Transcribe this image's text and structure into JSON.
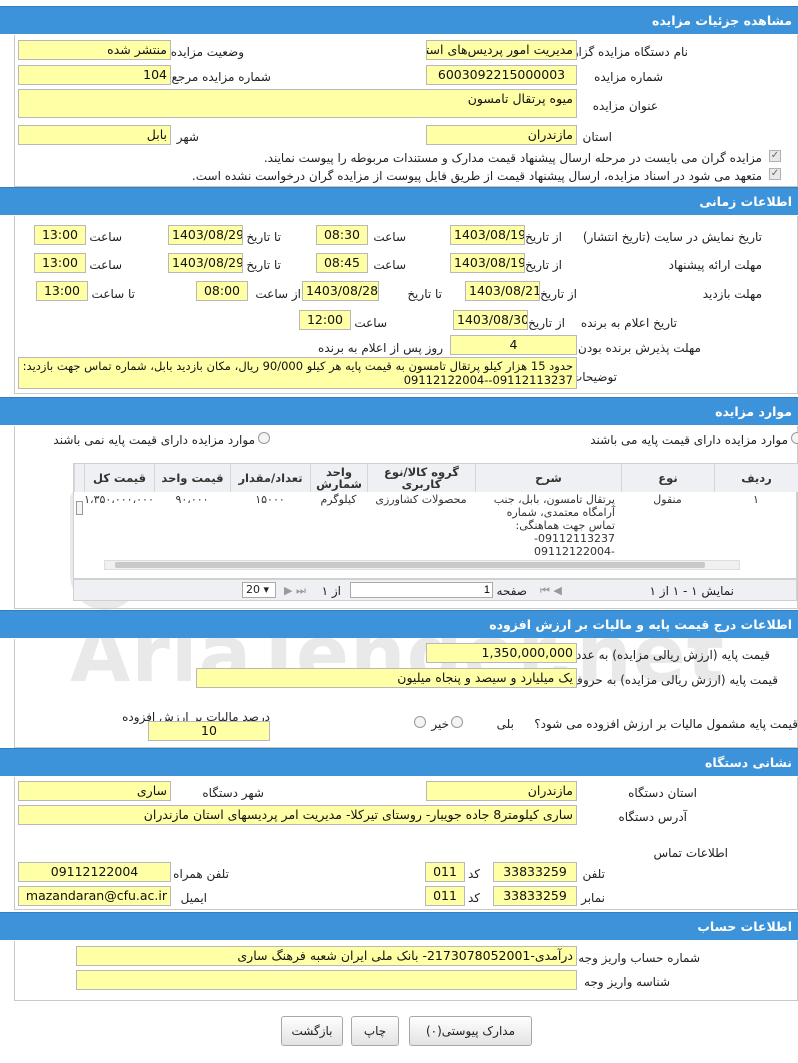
{
  "sections": {
    "details": "مشاهده جزئیات مزایده",
    "time": "اطلاعات زمانی",
    "items": "موارد مزایده",
    "price": "اطلاعات درج قیمت پایه و مالیات بر ارزش افزوده",
    "org": "نشانی دستگاه",
    "account": "اطلاعات حساب"
  },
  "details": {
    "org_label": "نام دستگاه مزایده گزار",
    "org_value": "مدیریت امور پردیس‌های استان مازندران",
    "status_label": "وضعیت مزایده",
    "status_value": "منتشر شده",
    "number_label": "شماره مزایده",
    "number_value": "6003092215000003",
    "ref_label": "شماره مزایده مرجع",
    "ref_value": "104",
    "title_label": "عنوان مزایده",
    "title_value": "میوه پرتقال تامسون",
    "province_label": "استان",
    "province_value": "مازندران",
    "city_label": "شهر",
    "city_value": "بابل",
    "check1": "مزایده گران می بایست در مرحله ارسال پیشنهاد قیمت مدارک و مستندات مربوطه را پیوست نمایند.",
    "check2": "متعهد می شود در اسناد مزایده، ارسال پیشنهاد قیمت از طریق فایل پیوست از مزایده گران درخواست نشده است."
  },
  "time": {
    "from": "از تاریخ",
    "to": "تا تاریخ",
    "hour": "ساعت",
    "from_hour": "از ساعت",
    "to_hour": "تا ساعت",
    "r1_label": "تاریخ نمایش در سایت (تاریخ انتشار)",
    "r1_from": "1403/08/19",
    "r1_from_time": "08:30",
    "r1_to": "1403/08/29",
    "r1_to_time": "13:00",
    "r2_label": "مهلت ارائه پیشنهاد",
    "r2_from": "1403/08/19",
    "r2_from_time": "08:45",
    "r2_to": "1403/08/29",
    "r2_to_time": "13:00",
    "r3_label": "مهلت بازدید",
    "r3_from": "1403/08/21",
    "r3_to": "1403/08/28",
    "r3_from_time": "08:00",
    "r3_to_time": "13:00",
    "r4_label": "تاریخ اعلام به برنده",
    "r4_from": "1403/08/30",
    "r4_time": "12:00",
    "r5_label": "مهلت پذیرش برنده بودن",
    "r5_value": "4",
    "r5_suffix": "روز پس از اعلام به برنده",
    "desc_label": "توضیحات",
    "desc_value": "حدود 15 هزار کیلو پرتقال تامسون به قیمت پایه هر کیلو 90/000 ریال، مکان بازدید بابل، شماره تماس جهت بازدید: 09112113237--09112122004"
  },
  "items": {
    "radio_has": "موارد مزایده دارای قیمت پایه می باشند",
    "radio_not": "موارد مزایده دارای قیمت پایه نمی باشند",
    "headers": [
      "ردیف",
      "نوع",
      "شرح",
      "گروه کالا/نوع کاربری",
      "واحد شمارش",
      "تعداد/مقدار",
      "قیمت واحد",
      "قیمت کل"
    ],
    "row": {
      "idx": "۱",
      "type": "منقول",
      "desc": "پرتقال تامسون، بابل، جنب آرامگاه معتمدی، شماره تماس جهت هماهنگی: 09112113237--09112122004",
      "group": "محصولات کشاورزی",
      "unit": "کیلوگرم",
      "qty": "۱۵۰۰۰",
      "unit_price": "۹۰،۰۰۰",
      "total": "۱،۳۵۰،۰۰۰،۰۰۰"
    },
    "pager_show": "نمایش ۱ - ۱ از ۱",
    "pager_page": "صفحه",
    "pager_page_val": "1",
    "pager_of": "از ۱",
    "pager_size": "20"
  },
  "price": {
    "base_num_label": "قیمت پایه (ارزش ریالی مزایده) به عدد",
    "base_num": "1,350,000,000",
    "base_text_label": "قیمت پایه (ارزش ریالی مزایده) به حروف",
    "base_text": "یک میلیارد و سیصد و پنجاه میلیون",
    "vat_question": "قیمت پایه مشمول مالیات بر ارزش افزوده می شود؟",
    "yes": "بلی",
    "no": "خیر",
    "vat_pct_label": "درصد مالیات بر ارزش افزوده",
    "vat_pct": "10"
  },
  "org": {
    "province_label": "استان دستگاه",
    "province": "مازندران",
    "city_label": "شهر دستگاه",
    "city": "ساری",
    "address_label": "آدرس دستگاه",
    "address": "ساری کیلومتر8 جاده جویبار- روستای تیرکلا- مدیریت امر پردیسهای استان مازندران",
    "contact": "اطلاعات تماس",
    "phone_label": "تلفن",
    "phone": "33833259",
    "code_label": "کد",
    "phone_code": "011",
    "mobile_label": "تلفن همراه",
    "mobile": "09112122004",
    "fax_label": "نمابر",
    "fax": "33833259",
    "fax_code": "011",
    "email_label": "ایمیل",
    "email": "mazandaran@cfu.ac.ir"
  },
  "account": {
    "acc_label": "شماره حساب واریز وجه",
    "acc_value": "درآمدی-2173078052001- بانک ملی ایران شعبه فرهنگ ساری",
    "id_label": "شناسه واریز وجه",
    "id_value": ""
  },
  "buttons": {
    "attach": "مدارک پیوستی(۰)",
    "print": "چاپ",
    "back": "بازگشت"
  },
  "watermark": "AriaTender.net"
}
